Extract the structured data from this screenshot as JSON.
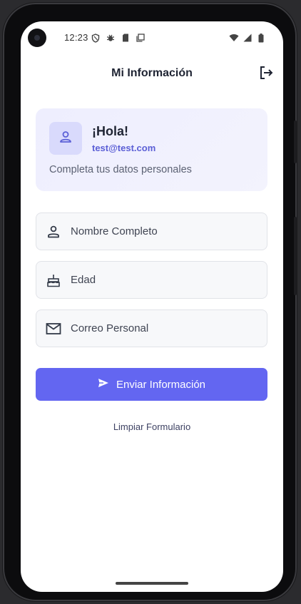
{
  "status_bar": {
    "time": "12:23",
    "left_icons": [
      "shield-icon",
      "bug-icon",
      "sd-card-icon",
      "copy-icon"
    ],
    "right_icons": [
      "wifi-icon",
      "signal-icon",
      "battery-icon"
    ]
  },
  "app_bar": {
    "title": "Mi Información",
    "logout_icon": "logout-icon"
  },
  "greeting": {
    "title": "¡Hola!",
    "email": "test@test.com",
    "subtitle": "Completa tus datos personales",
    "avatar_icon": "person-icon"
  },
  "form": {
    "fields": [
      {
        "icon": "person-icon",
        "placeholder": "Nombre Completo",
        "value": ""
      },
      {
        "icon": "cake-icon",
        "placeholder": "Edad",
        "value": ""
      },
      {
        "icon": "mail-icon",
        "placeholder": "Correo Personal",
        "value": ""
      }
    ],
    "submit_label": "Enviar Información",
    "submit_icon": "send-icon",
    "clear_label": "Limpiar Formulario"
  },
  "colors": {
    "primary": "#6366f1",
    "card_bg": "#eeeefe",
    "email_accent": "#5b5fd6",
    "field_bg": "#f7f8fa"
  }
}
